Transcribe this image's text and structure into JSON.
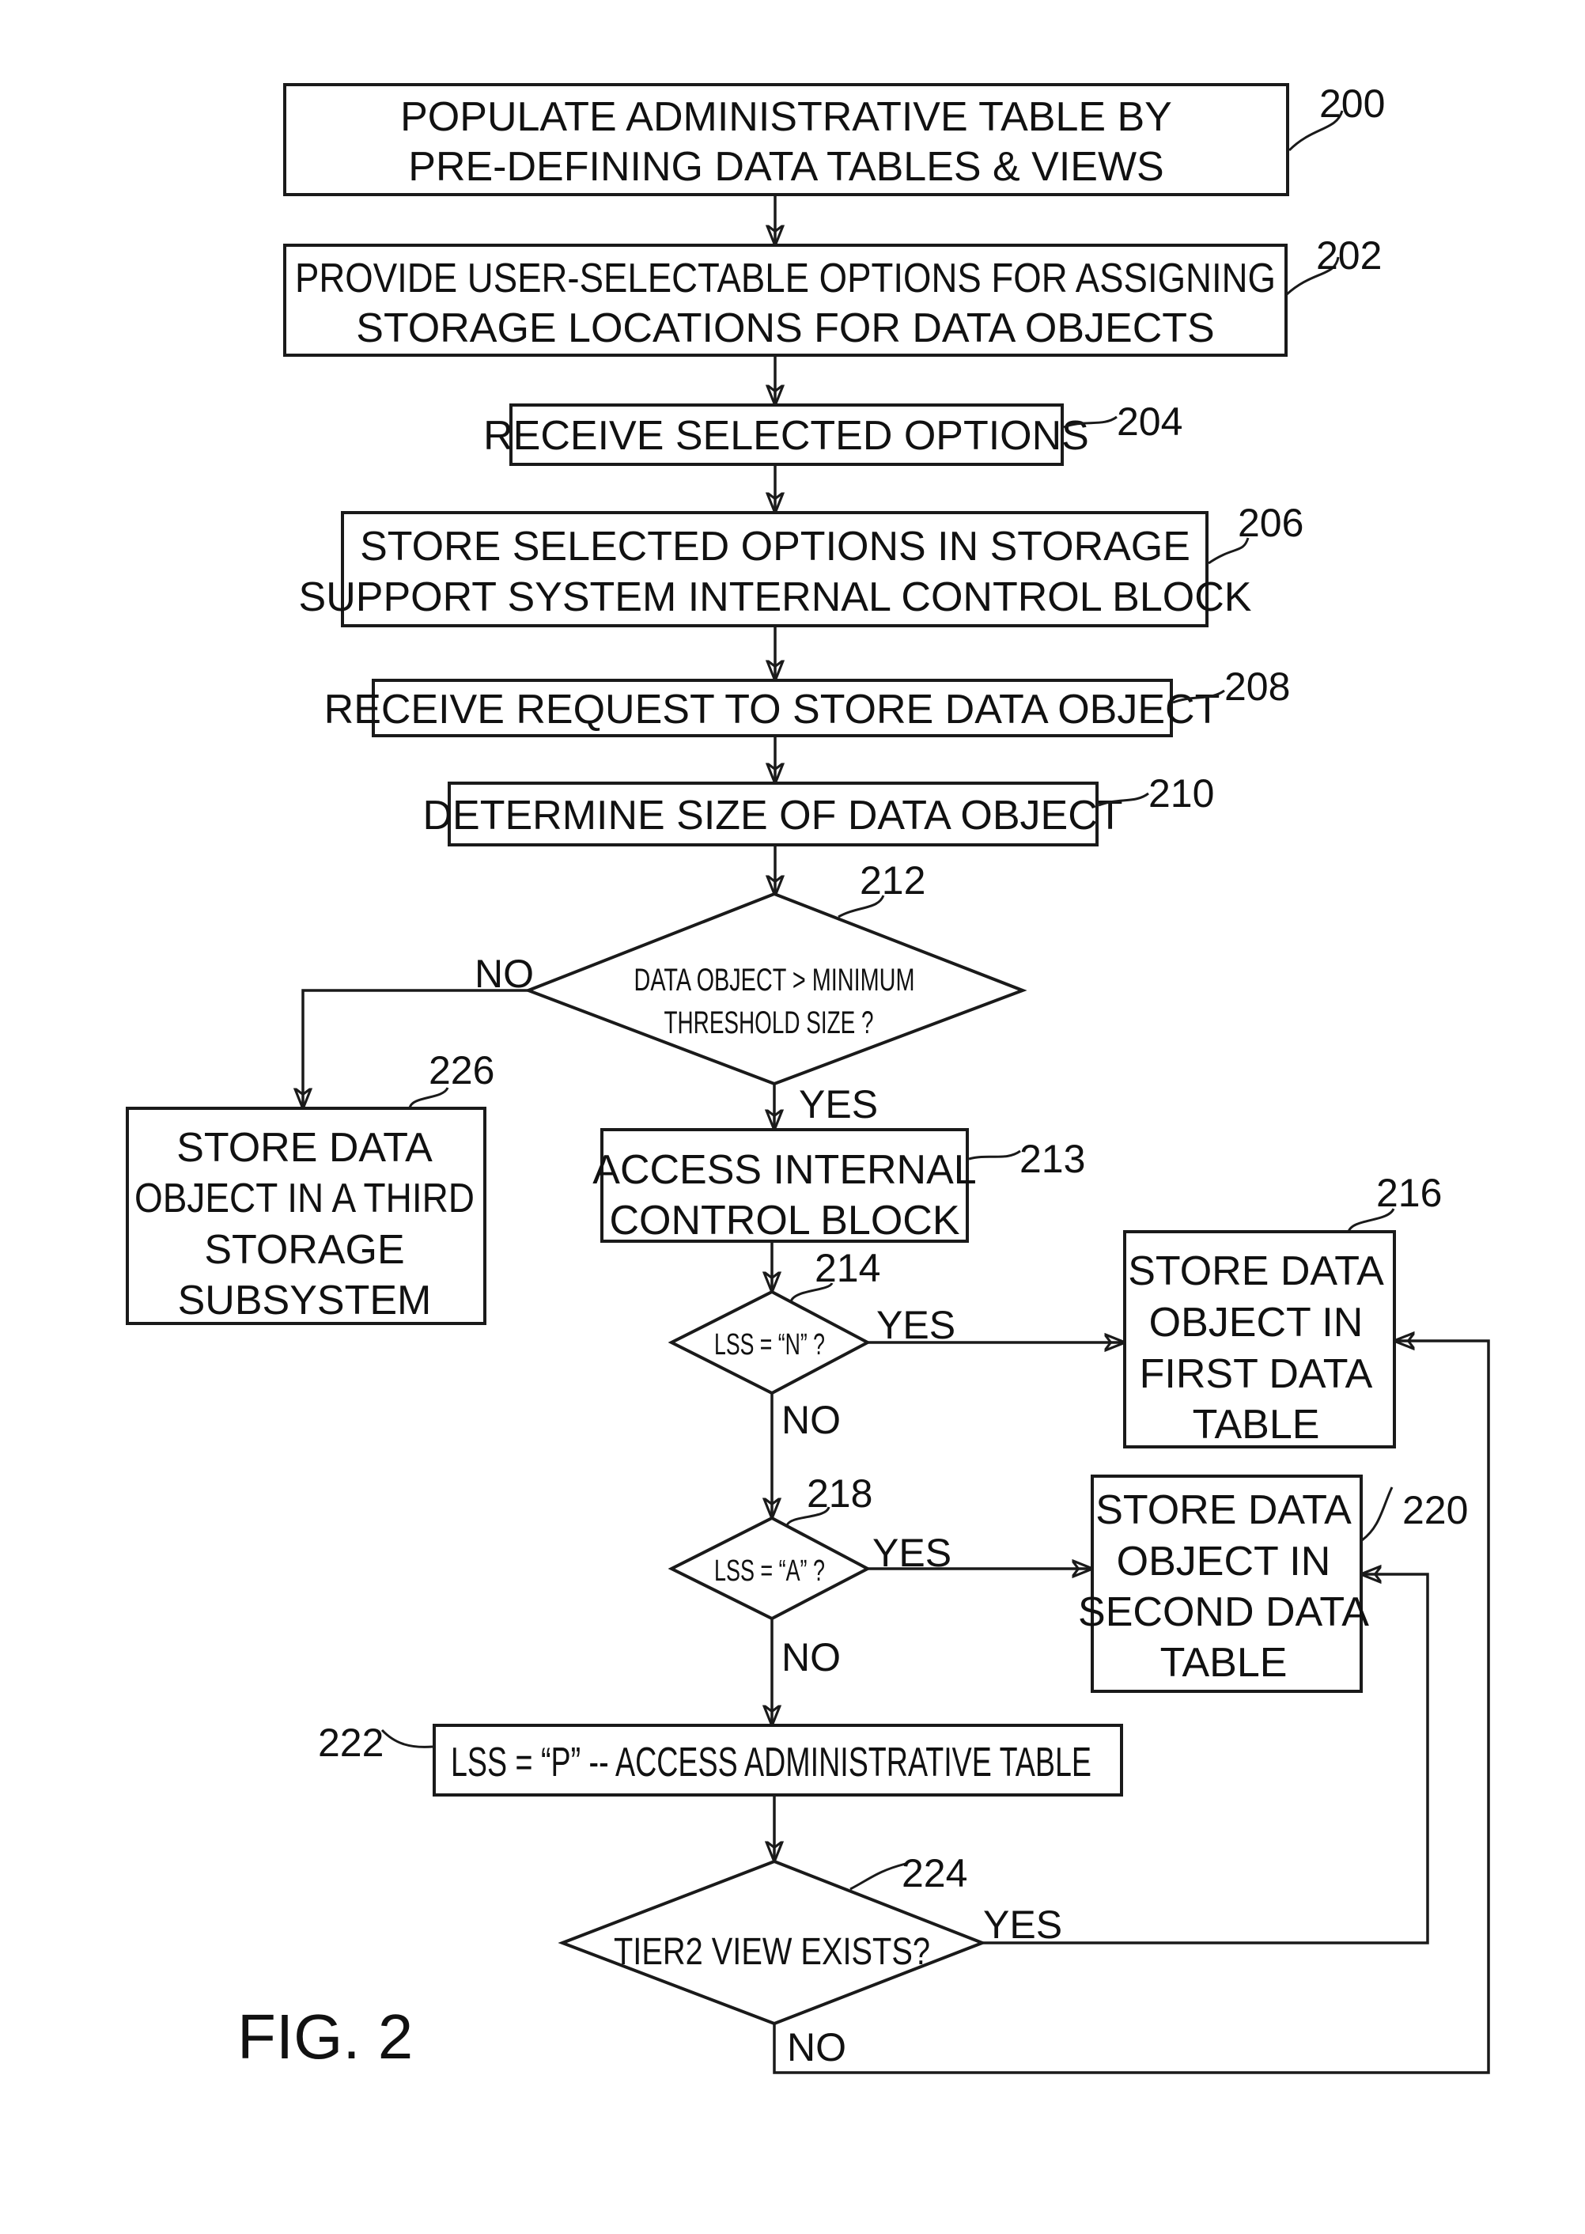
{
  "figure_label": "FIG. 2",
  "steps": {
    "s200": {
      "ref": "200",
      "lines": [
        "POPULATE ADMINISTRATIVE TABLE BY",
        "PRE-DEFINING DATA TABLES & VIEWS"
      ]
    },
    "s202": {
      "ref": "202",
      "lines": [
        "PROVIDE USER-SELECTABLE OPTIONS FOR ASSIGNING",
        "STORAGE LOCATIONS FOR DATA OBJECTS"
      ]
    },
    "s204": {
      "ref": "204",
      "lines": [
        "RECEIVE SELECTED OPTIONS"
      ]
    },
    "s206": {
      "ref": "206",
      "lines": [
        "STORE SELECTED OPTIONS IN STORAGE",
        "SUPPORT SYSTEM INTERNAL CONTROL BLOCK"
      ]
    },
    "s208": {
      "ref": "208",
      "lines": [
        "RECEIVE REQUEST TO STORE DATA OBJECT"
      ]
    },
    "s210": {
      "ref": "210",
      "lines": [
        "DETERMINE SIZE OF DATA OBJECT"
      ]
    },
    "s212": {
      "ref": "212",
      "lines": [
        "DATA OBJECT > MINIMUM",
        "THRESHOLD SIZE ?"
      ]
    },
    "s213": {
      "ref": "213",
      "lines": [
        "ACCESS INTERNAL",
        "CONTROL BLOCK"
      ]
    },
    "s214": {
      "ref": "214",
      "lines": [
        "LSS = “N” ?"
      ]
    },
    "s216": {
      "ref": "216",
      "lines": [
        "STORE DATA",
        "OBJECT IN",
        "FIRST DATA",
        "TABLE"
      ]
    },
    "s218": {
      "ref": "218",
      "lines": [
        "LSS = “A” ?"
      ]
    },
    "s220": {
      "ref": "220",
      "lines": [
        "STORE DATA",
        "OBJECT IN",
        "SECOND DATA",
        "TABLE"
      ]
    },
    "s222": {
      "ref": "222",
      "lines": [
        "LSS = “P” -- ACCESS ADMINISTRATIVE TABLE"
      ]
    },
    "s224": {
      "ref": "224",
      "lines": [
        "TIER2 VIEW EXISTS?"
      ]
    },
    "s226": {
      "ref": "226",
      "lines": [
        "STORE DATA",
        "OBJECT IN A THIRD",
        "STORAGE",
        "SUBSYSTEM"
      ]
    }
  },
  "branch_labels": {
    "d212_no": "NO",
    "d212_yes": "YES",
    "d214_yes": "YES",
    "d214_no": "NO",
    "d218_yes": "YES",
    "d218_no": "NO",
    "d224_yes": "YES",
    "d224_no": "NO"
  }
}
